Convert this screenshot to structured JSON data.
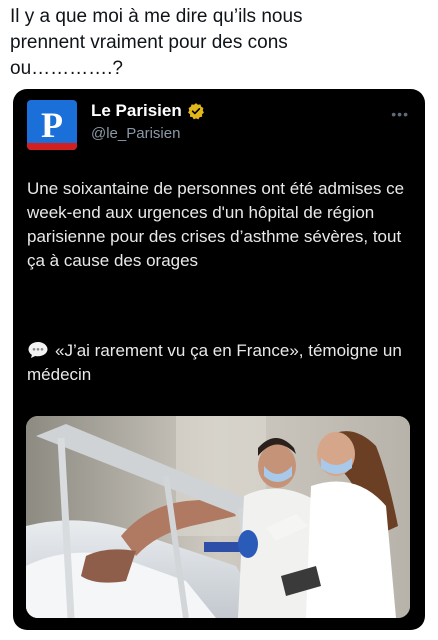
{
  "post": {
    "text": "Il y a que moi à me dire qu’ils nous\nprennent vraiment pour des cons\nou………….?"
  },
  "embedded_tweet": {
    "logo_letter": "P",
    "display_name": "Le Parisien",
    "handle": "@le_Parisien",
    "more_icon": "ellipsis-icon",
    "body": "Une soixantaine de personnes ont été admises ce week-end aux urgences d'un hôpital de région parisienne pour des crises d’asthme sévères, tout ça à cause des orages",
    "quote_icon": "speech-bubble-icon",
    "quote": "«J’ai rarement vu ça en France», témoigne un médecin",
    "colors": {
      "card_bg": "#000000",
      "logo_blue": "#1b6fd8",
      "logo_red": "#d21f1f",
      "verified_gold": "#e2b719",
      "text": "#e7e9ea",
      "muted": "#8b98a5"
    }
  }
}
